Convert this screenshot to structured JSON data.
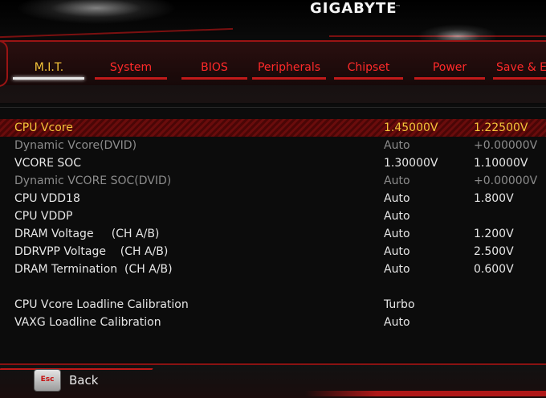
{
  "brand": {
    "logo": "GIGABYTE",
    "mark": "™"
  },
  "tabs": [
    {
      "label": "M.I.T.",
      "active": true
    },
    {
      "label": "System",
      "active": false
    },
    {
      "label": "BIOS",
      "active": false
    },
    {
      "label": "Peripherals",
      "active": false
    },
    {
      "label": "Chipset",
      "active": false
    },
    {
      "label": "Power",
      "active": false
    },
    {
      "label": "Save & E",
      "active": false
    }
  ],
  "settings": [
    {
      "label": "CPU Vcore",
      "value": "1.45000V",
      "current": "1.22500V",
      "state": "selected"
    },
    {
      "label": "Dynamic Vcore(DVID)",
      "value": "Auto",
      "current": "+0.00000V",
      "state": "dim"
    },
    {
      "label": "VCORE SOC",
      "value": "1.30000V",
      "current": "1.10000V",
      "state": "normal"
    },
    {
      "label": "Dynamic VCORE SOC(DVID)",
      "value": "Auto",
      "current": "+0.00000V",
      "state": "dim"
    },
    {
      "label": "CPU VDD18",
      "value": "Auto",
      "current": "1.800V",
      "state": "normal"
    },
    {
      "label": "CPU VDDP",
      "value": "Auto",
      "current": "",
      "state": "normal"
    },
    {
      "label": "DRAM Voltage     (CH A/B)",
      "value": "Auto",
      "current": "1.200V",
      "state": "normal"
    },
    {
      "label": "DDRVPP Voltage    (CH A/B)",
      "value": "Auto",
      "current": "2.500V",
      "state": "normal"
    },
    {
      "label": "DRAM Termination  (CH A/B)",
      "value": "Auto",
      "current": "0.600V",
      "state": "normal"
    },
    {
      "label": "CPU Vcore Loadline Calibration",
      "value": "Turbo",
      "current": "",
      "state": "normal"
    },
    {
      "label": "VAXG Loadline Calibration",
      "value": "Auto",
      "current": "",
      "state": "normal"
    }
  ],
  "footer": {
    "esc_key": "Esc",
    "back_label": "Back"
  },
  "colors": {
    "accent_red": "#ff2a2a",
    "selected_yellow": "#f6c53a",
    "dim_text": "#8c8c8c"
  }
}
